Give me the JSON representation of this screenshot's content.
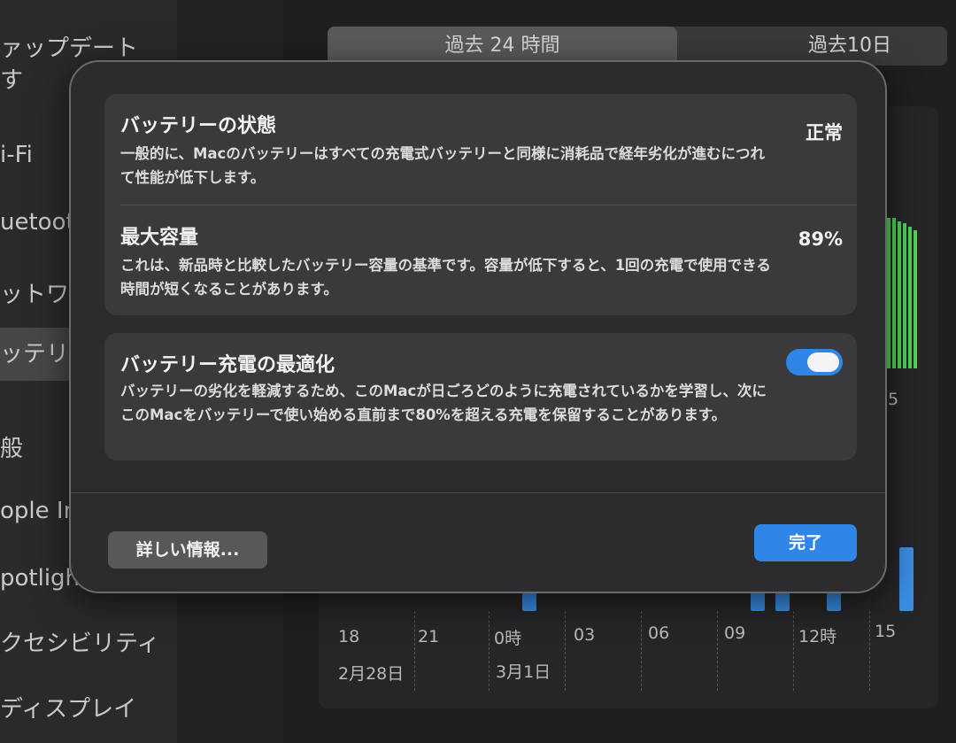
{
  "sidebar": {
    "items": [
      {
        "label": "ァップデート"
      },
      {
        "label": "す"
      },
      {
        "label": "i-Fi"
      },
      {
        "label": "uetoot"
      },
      {
        "label": "ットワ"
      },
      {
        "label": "ッテリ"
      },
      {
        "label": "般"
      },
      {
        "label": "ople In"
      },
      {
        "label": "potligh"
      },
      {
        "label": "クセシビリティ"
      },
      {
        "label": "ディスプレイ"
      }
    ]
  },
  "segmented": {
    "tab_24h": "過去 24 時間",
    "tab_10d": "過去10日"
  },
  "chart": {
    "x_ticks": [
      "18",
      "21",
      "0時",
      "03",
      "06",
      "09",
      "12時",
      "15"
    ],
    "date_labels": [
      "2月28日",
      "3月1日"
    ],
    "y_partial": "5"
  },
  "dialog": {
    "health": {
      "title": "バッテリーの状態",
      "value": "正常",
      "description": "一般的に、Macのバッテリーはすべての充電式バッテリーと同様に消耗品で経年劣化が進むにつれて性能が低下します。"
    },
    "capacity": {
      "title": "最大容量",
      "value": "89%",
      "description": "これは、新品時と比較したバッテリー容量の基準です。容量が低下すると、1回の充電で使用できる時間が短くなることがあります。"
    },
    "optimize": {
      "title": "バッテリー充電の最適化",
      "enabled": true,
      "description": "バッテリーの劣化を軽減するため、このMacが日ごろどのように充電されているかを学習し、次にこのMacをバッテリーで使い始める直前まで80%を超える充電を保留することがあります。"
    },
    "more_info_button": "詳しい情報...",
    "done_button": "完了"
  },
  "colors": {
    "accent": "#2f86e6",
    "chart_green": "#4fd35a",
    "chart_blue": "#3a8ee6"
  }
}
